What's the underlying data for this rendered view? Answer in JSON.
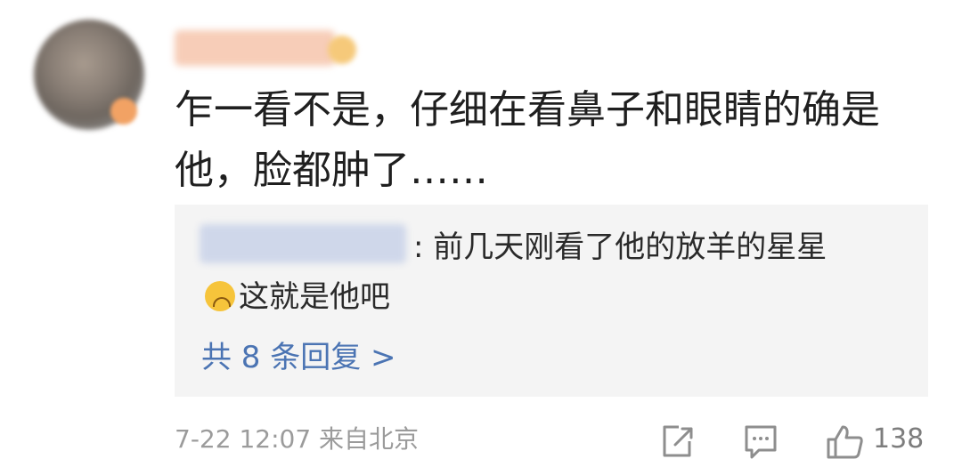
{
  "comment": {
    "username": "",
    "text": "乍一看不是，仔细在看鼻子和眼睛的确是他，脸都肿了……",
    "reply": {
      "user": "",
      "text": ": 前几天刚看了他的放羊的星星",
      "text_line2": "这就是他吧",
      "emoji": "crying-face-icon"
    },
    "more_replies_label": "共 8 条回复 >",
    "meta": "7-22 12:07 来自北京",
    "like_count": "138"
  },
  "icons": {
    "share": "share-icon",
    "reply": "comment-icon",
    "like": "thumbs-up-icon"
  }
}
